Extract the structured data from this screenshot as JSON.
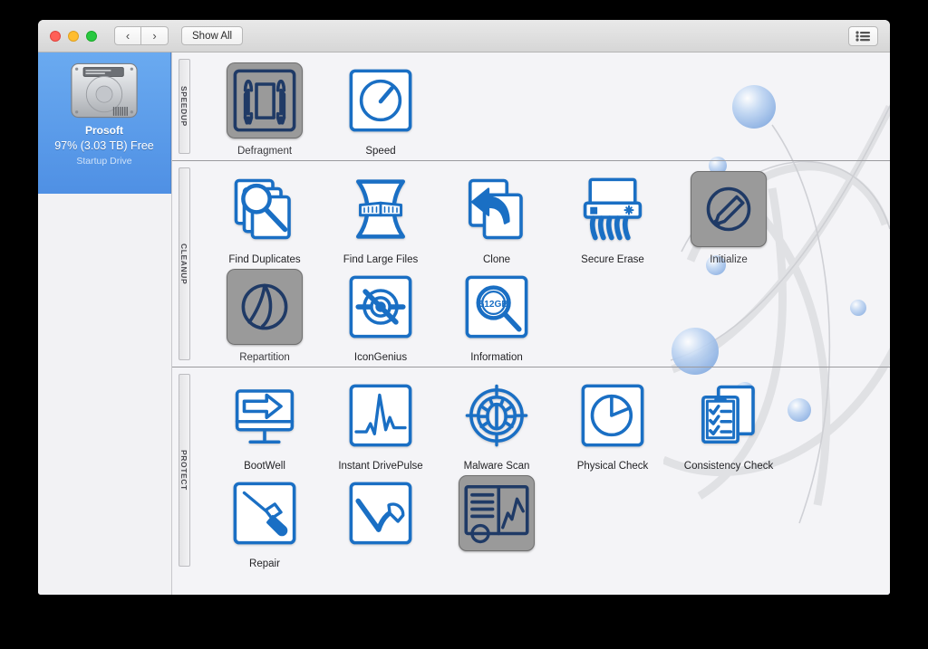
{
  "window": {
    "traffic_lights": [
      "close",
      "minimize",
      "zoom"
    ],
    "nav_back_label": "‹",
    "nav_forward_label": "›",
    "show_all_label": "Show All",
    "view_button_icon": "list-view-icon",
    "accent_blue": "#1a6fc4",
    "disabled_fill": "#9a9a9a",
    "disabled_stroke": "#1f3a66"
  },
  "sidebar": {
    "drive": {
      "icon": "hard-drive-icon",
      "name": "Prosoft",
      "free": "97% (3.03 TB) Free",
      "subtitle": "Startup Drive",
      "selected": true
    }
  },
  "sections": [
    {
      "rail_label": "SPEEDUP",
      "tiles": [
        {
          "label": "Defragment",
          "icon": "rockets-icon",
          "enabled": false
        },
        {
          "label": "Speed",
          "icon": "gauge-icon",
          "enabled": true
        }
      ]
    },
    {
      "rail_label": "CLEANUP",
      "tiles": [
        {
          "label": "Find Duplicates",
          "icon": "magnifier-stack-icon",
          "enabled": true
        },
        {
          "label": "Find Large Files",
          "icon": "tape-measure-icon",
          "enabled": true
        },
        {
          "label": "Clone",
          "icon": "clone-arrow-icon",
          "enabled": true
        },
        {
          "label": "Secure Erase",
          "icon": "shredder-icon",
          "enabled": true
        },
        {
          "label": "Initialize",
          "icon": "pencil-circle-icon",
          "enabled": false
        },
        {
          "label": "Repartition",
          "icon": "pie-partition-icon",
          "enabled": false
        },
        {
          "label": "IconGenius",
          "icon": "target-rings-icon",
          "enabled": true
        },
        {
          "label": "Information",
          "icon": "magnifier-size-icon",
          "enabled": true,
          "icon_text": "512GB"
        }
      ]
    },
    {
      "rail_label": "PROTECT",
      "tiles": [
        {
          "label": "BootWell",
          "icon": "monitor-arrow-icon",
          "enabled": true
        },
        {
          "label": "Instant DrivePulse",
          "icon": "pulse-graph-icon",
          "enabled": true
        },
        {
          "label": "Malware Scan",
          "icon": "bug-target-icon",
          "enabled": true
        },
        {
          "label": "Physical Check",
          "icon": "pie-chart-icon",
          "enabled": true
        },
        {
          "label": "Consistency Check",
          "icon": "checklist-icon",
          "enabled": true
        },
        {
          "label": "Repair",
          "icon": "screwdriver-icon",
          "enabled": true
        },
        {
          "label": "",
          "icon": "hammer-check-icon",
          "enabled": true
        },
        {
          "label": "",
          "icon": "dashboard-icon",
          "enabled": false
        }
      ]
    }
  ]
}
